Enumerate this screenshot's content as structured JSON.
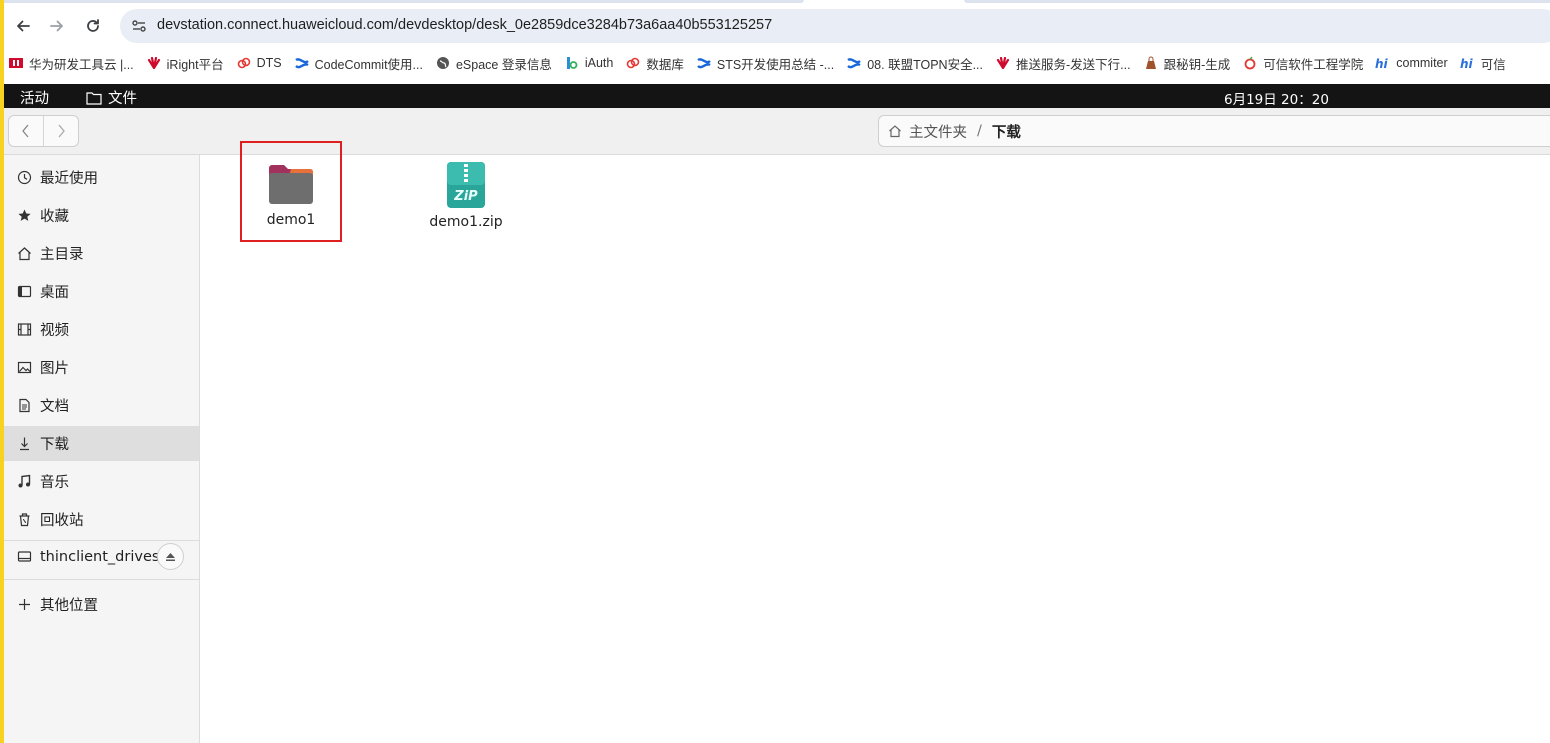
{
  "browser": {
    "url": "devstation.connect.huaweicloud.com/devdesktop/desk_0e2859dce3284b73a6aa40b553125257",
    "bookmarks": [
      {
        "label": "华为研发工具云 |...",
        "icon": "huawei-red-icon",
        "color": "#cf0a2c"
      },
      {
        "label": "iRight平台",
        "icon": "huawei-flower-icon",
        "color": "#cf0a2c"
      },
      {
        "label": "DTS",
        "icon": "cloud-link-icon",
        "color": "#e53935"
      },
      {
        "label": "CodeCommit使用...",
        "icon": "confluence-icon",
        "color": "#1868db"
      },
      {
        "label": "eSpace 登录信息",
        "icon": "globe-icon",
        "color": "#555555"
      },
      {
        "label": "iAuth",
        "icon": "iauth-icon",
        "color": "#2a8fd8"
      },
      {
        "label": "数据库",
        "icon": "cloud-link-icon",
        "color": "#e53935"
      },
      {
        "label": "STS开发使用总结 -...",
        "icon": "confluence-icon",
        "color": "#1868db"
      },
      {
        "label": "08. 联盟TOPN安全...",
        "icon": "confluence-icon",
        "color": "#1868db"
      },
      {
        "label": "推送服务-发送下行...",
        "icon": "huawei-flower-icon",
        "color": "#cf0a2c"
      },
      {
        "label": "跟秘钥-生成",
        "icon": "bag-icon",
        "color": "#a0522d"
      },
      {
        "label": "可信软件工程学院",
        "icon": "apple-icon",
        "color": "#e53935"
      },
      {
        "label": "commiter",
        "icon": "hi-icon",
        "color": "#2a6fdb"
      },
      {
        "label": "可信",
        "icon": "hi-icon",
        "color": "#2a6fdb"
      }
    ]
  },
  "topbar": {
    "activities": "活动",
    "app_name": "文件",
    "clock": "6月19日  20：20"
  },
  "pathbar": {
    "home": "主文件夹",
    "current": "下载"
  },
  "sidebar": {
    "items": [
      {
        "label": "最近使用",
        "icon": "recent-icon"
      },
      {
        "label": "收藏",
        "icon": "star-icon"
      },
      {
        "label": "主目录",
        "icon": "home-icon"
      },
      {
        "label": "桌面",
        "icon": "desktop-icon"
      },
      {
        "label": "视频",
        "icon": "video-icon"
      },
      {
        "label": "图片",
        "icon": "image-icon"
      },
      {
        "label": "文档",
        "icon": "document-icon"
      },
      {
        "label": "下载",
        "icon": "download-icon",
        "active": true
      },
      {
        "label": "音乐",
        "icon": "music-icon"
      },
      {
        "label": "回收站",
        "icon": "trash-icon"
      }
    ],
    "drive": {
      "label": "thinclient_drives",
      "icon": "drive-icon"
    },
    "other": {
      "label": "其他位置",
      "icon": "plus-icon"
    }
  },
  "files": [
    {
      "name": "demo1",
      "type": "folder",
      "icon": "folder-icon"
    },
    {
      "name": "demo1.zip",
      "type": "zip",
      "icon": "zip-icon"
    }
  ]
}
